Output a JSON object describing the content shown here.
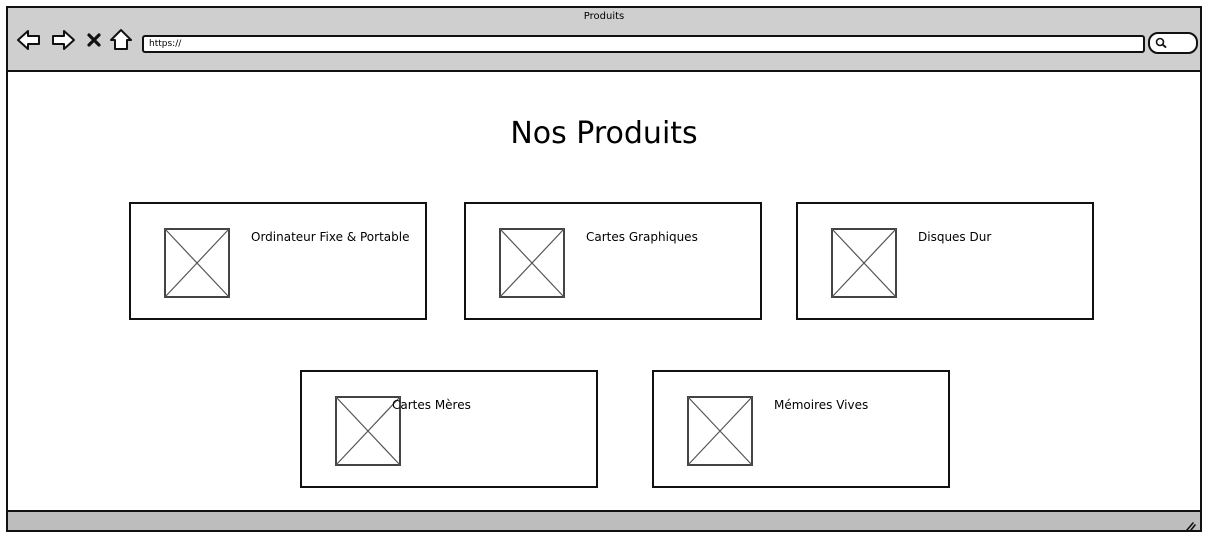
{
  "browser": {
    "window_title": "Produits",
    "url": "https://",
    "icons": {
      "back": "arrow-left-outline",
      "forward": "arrow-right-outline",
      "stop": "x-mark",
      "home": "house-outline",
      "search": "magnifier"
    }
  },
  "page": {
    "title": "Nos Produits",
    "products": [
      {
        "label": "Ordinateur Fixe & Portable",
        "image": "image-placeholder"
      },
      {
        "label": "Cartes Graphiques",
        "image": "image-placeholder"
      },
      {
        "label": "Disques Dur",
        "image": "image-placeholder"
      },
      {
        "label": "Cartes Mères",
        "image": "image-placeholder"
      },
      {
        "label": "Mémoires Vives",
        "image": "image-placeholder"
      }
    ]
  },
  "colors": {
    "chrome": "#cfcfcf",
    "statusbar": "#bdbdbd",
    "stroke": "#111111",
    "placeholder_stroke": "#444444"
  }
}
